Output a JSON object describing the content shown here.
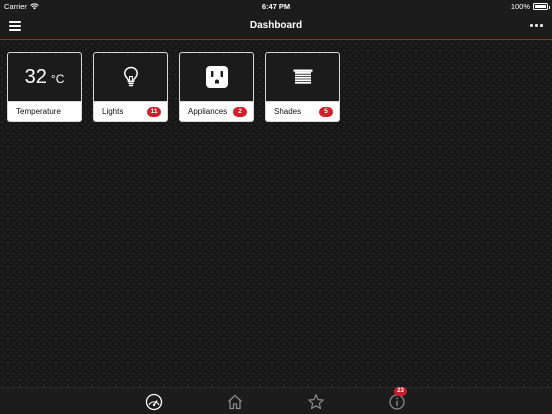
{
  "status_bar": {
    "carrier": "Carrier",
    "time": "6:47 PM",
    "battery": "100%"
  },
  "header": {
    "title": "Dashboard"
  },
  "tiles": [
    {
      "id": "temperature",
      "label": "Temperature",
      "value": "32",
      "unit": "°C"
    },
    {
      "id": "lights",
      "label": "Lights",
      "badge": "11",
      "icon": "lightbulb-icon"
    },
    {
      "id": "appliances",
      "label": "Appliances",
      "badge": "2",
      "icon": "outlet-icon"
    },
    {
      "id": "shades",
      "label": "Shades",
      "badge": "5",
      "icon": "shades-icon"
    }
  ],
  "tab_bar": {
    "items": [
      {
        "id": "dashboard",
        "icon": "gauge-icon"
      },
      {
        "id": "home",
        "icon": "home-icon"
      },
      {
        "id": "favorites",
        "icon": "star-icon"
      },
      {
        "id": "info",
        "icon": "info-icon",
        "badge": "23"
      }
    ]
  },
  "colors": {
    "accent": "#c41e2a",
    "badge": "#d31f2b",
    "background": "#161616",
    "bar": "#1c1c1c"
  }
}
